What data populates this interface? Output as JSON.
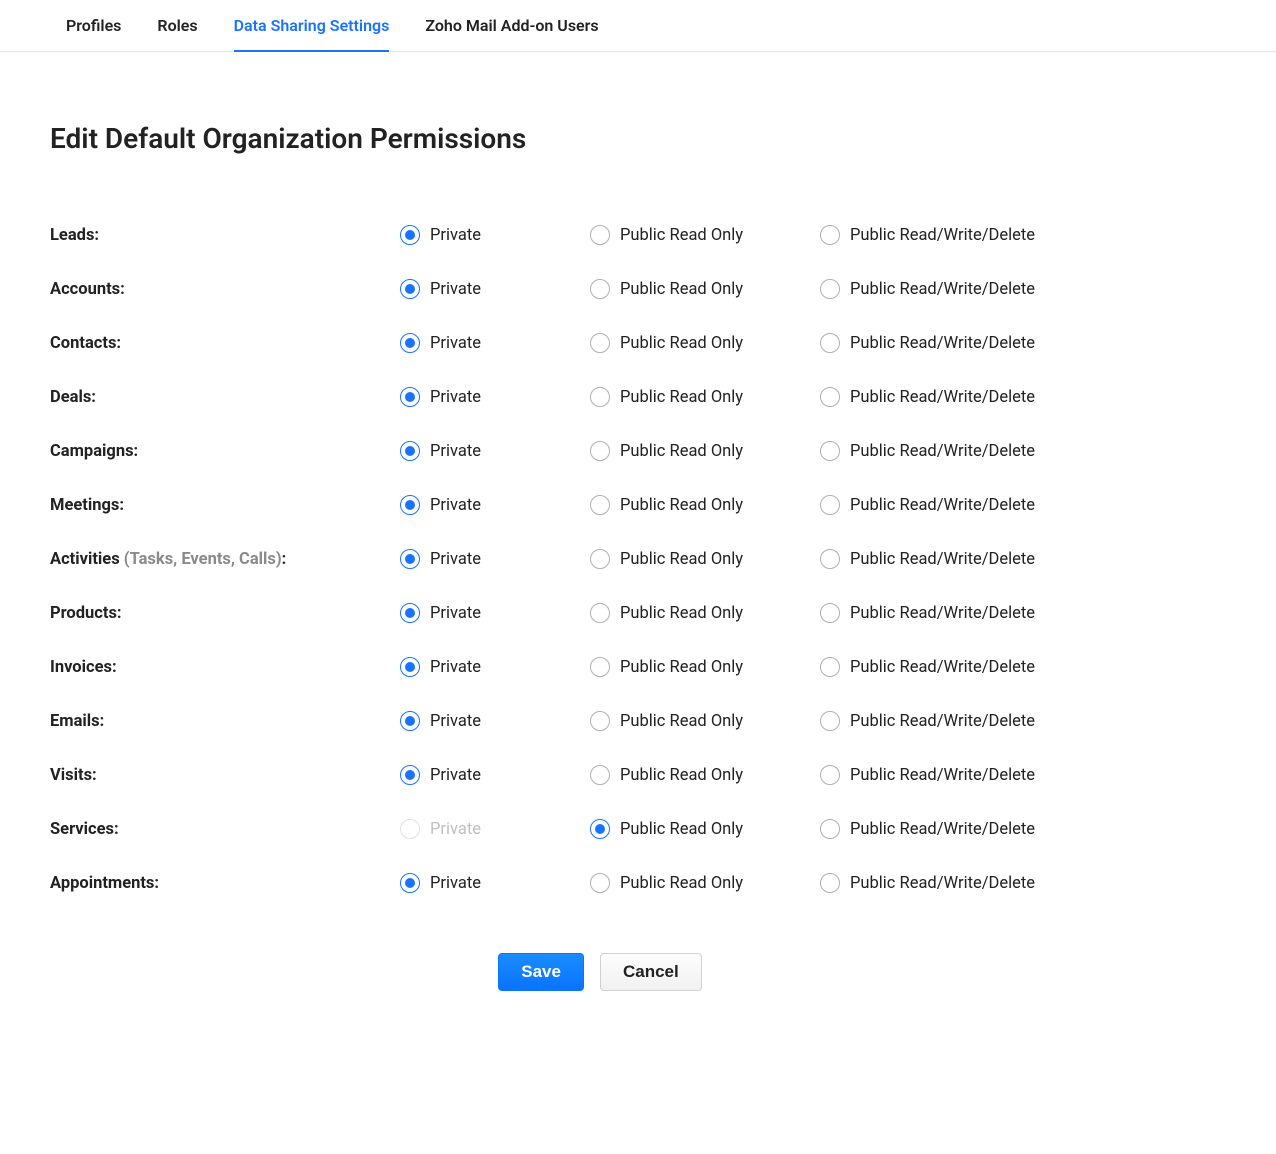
{
  "tabs": [
    {
      "label": "Profiles",
      "active": false
    },
    {
      "label": "Roles",
      "active": false
    },
    {
      "label": "Data Sharing Settings",
      "active": true
    },
    {
      "label": "Zoho Mail Add-on Users",
      "active": false
    }
  ],
  "page_title": "Edit Default Organization Permissions",
  "options": {
    "private": "Private",
    "public_read": "Public Read Only",
    "public_rwd": "Public Read/Write/Delete"
  },
  "rows": [
    {
      "label": "Leads:",
      "selected": "private",
      "disabled": []
    },
    {
      "label": "Accounts:",
      "selected": "private",
      "disabled": []
    },
    {
      "label": "Contacts:",
      "selected": "private",
      "disabled": []
    },
    {
      "label": "Deals:",
      "selected": "private",
      "disabled": []
    },
    {
      "label": "Campaigns:",
      "selected": "private",
      "disabled": []
    },
    {
      "label": "Meetings:",
      "selected": "private",
      "disabled": []
    },
    {
      "label": "Activities",
      "label_suffix_muted": " (Tasks, Events, Calls)",
      "label_tail": ":",
      "selected": "private",
      "disabled": []
    },
    {
      "label": "Products:",
      "selected": "private",
      "disabled": []
    },
    {
      "label": "Invoices:",
      "selected": "private",
      "disabled": []
    },
    {
      "label": "Emails:",
      "selected": "private",
      "disabled": []
    },
    {
      "label": "Visits:",
      "selected": "private",
      "disabled": []
    },
    {
      "label": "Services:",
      "selected": "public_read",
      "disabled": [
        "private"
      ]
    },
    {
      "label": "Appointments:",
      "selected": "private",
      "disabled": []
    }
  ],
  "buttons": {
    "save": "Save",
    "cancel": "Cancel"
  }
}
